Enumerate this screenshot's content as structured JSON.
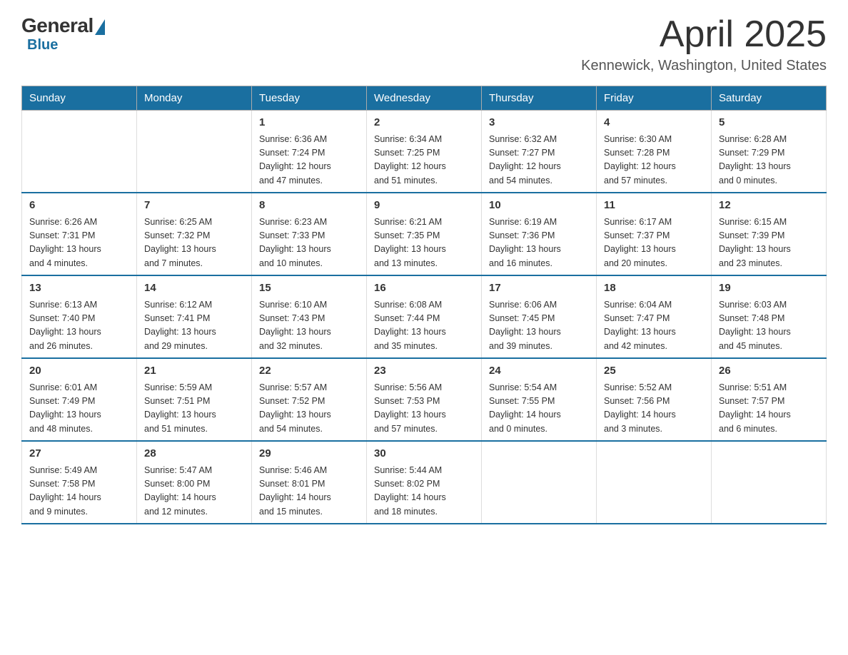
{
  "logo": {
    "general": "General",
    "blue": "Blue"
  },
  "header": {
    "month": "April 2025",
    "location": "Kennewick, Washington, United States"
  },
  "weekdays": [
    "Sunday",
    "Monday",
    "Tuesday",
    "Wednesday",
    "Thursday",
    "Friday",
    "Saturday"
  ],
  "weeks": [
    [
      {
        "day": "",
        "info": ""
      },
      {
        "day": "",
        "info": ""
      },
      {
        "day": "1",
        "info": "Sunrise: 6:36 AM\nSunset: 7:24 PM\nDaylight: 12 hours\nand 47 minutes."
      },
      {
        "day": "2",
        "info": "Sunrise: 6:34 AM\nSunset: 7:25 PM\nDaylight: 12 hours\nand 51 minutes."
      },
      {
        "day": "3",
        "info": "Sunrise: 6:32 AM\nSunset: 7:27 PM\nDaylight: 12 hours\nand 54 minutes."
      },
      {
        "day": "4",
        "info": "Sunrise: 6:30 AM\nSunset: 7:28 PM\nDaylight: 12 hours\nand 57 minutes."
      },
      {
        "day": "5",
        "info": "Sunrise: 6:28 AM\nSunset: 7:29 PM\nDaylight: 13 hours\nand 0 minutes."
      }
    ],
    [
      {
        "day": "6",
        "info": "Sunrise: 6:26 AM\nSunset: 7:31 PM\nDaylight: 13 hours\nand 4 minutes."
      },
      {
        "day": "7",
        "info": "Sunrise: 6:25 AM\nSunset: 7:32 PM\nDaylight: 13 hours\nand 7 minutes."
      },
      {
        "day": "8",
        "info": "Sunrise: 6:23 AM\nSunset: 7:33 PM\nDaylight: 13 hours\nand 10 minutes."
      },
      {
        "day": "9",
        "info": "Sunrise: 6:21 AM\nSunset: 7:35 PM\nDaylight: 13 hours\nand 13 minutes."
      },
      {
        "day": "10",
        "info": "Sunrise: 6:19 AM\nSunset: 7:36 PM\nDaylight: 13 hours\nand 16 minutes."
      },
      {
        "day": "11",
        "info": "Sunrise: 6:17 AM\nSunset: 7:37 PM\nDaylight: 13 hours\nand 20 minutes."
      },
      {
        "day": "12",
        "info": "Sunrise: 6:15 AM\nSunset: 7:39 PM\nDaylight: 13 hours\nand 23 minutes."
      }
    ],
    [
      {
        "day": "13",
        "info": "Sunrise: 6:13 AM\nSunset: 7:40 PM\nDaylight: 13 hours\nand 26 minutes."
      },
      {
        "day": "14",
        "info": "Sunrise: 6:12 AM\nSunset: 7:41 PM\nDaylight: 13 hours\nand 29 minutes."
      },
      {
        "day": "15",
        "info": "Sunrise: 6:10 AM\nSunset: 7:43 PM\nDaylight: 13 hours\nand 32 minutes."
      },
      {
        "day": "16",
        "info": "Sunrise: 6:08 AM\nSunset: 7:44 PM\nDaylight: 13 hours\nand 35 minutes."
      },
      {
        "day": "17",
        "info": "Sunrise: 6:06 AM\nSunset: 7:45 PM\nDaylight: 13 hours\nand 39 minutes."
      },
      {
        "day": "18",
        "info": "Sunrise: 6:04 AM\nSunset: 7:47 PM\nDaylight: 13 hours\nand 42 minutes."
      },
      {
        "day": "19",
        "info": "Sunrise: 6:03 AM\nSunset: 7:48 PM\nDaylight: 13 hours\nand 45 minutes."
      }
    ],
    [
      {
        "day": "20",
        "info": "Sunrise: 6:01 AM\nSunset: 7:49 PM\nDaylight: 13 hours\nand 48 minutes."
      },
      {
        "day": "21",
        "info": "Sunrise: 5:59 AM\nSunset: 7:51 PM\nDaylight: 13 hours\nand 51 minutes."
      },
      {
        "day": "22",
        "info": "Sunrise: 5:57 AM\nSunset: 7:52 PM\nDaylight: 13 hours\nand 54 minutes."
      },
      {
        "day": "23",
        "info": "Sunrise: 5:56 AM\nSunset: 7:53 PM\nDaylight: 13 hours\nand 57 minutes."
      },
      {
        "day": "24",
        "info": "Sunrise: 5:54 AM\nSunset: 7:55 PM\nDaylight: 14 hours\nand 0 minutes."
      },
      {
        "day": "25",
        "info": "Sunrise: 5:52 AM\nSunset: 7:56 PM\nDaylight: 14 hours\nand 3 minutes."
      },
      {
        "day": "26",
        "info": "Sunrise: 5:51 AM\nSunset: 7:57 PM\nDaylight: 14 hours\nand 6 minutes."
      }
    ],
    [
      {
        "day": "27",
        "info": "Sunrise: 5:49 AM\nSunset: 7:58 PM\nDaylight: 14 hours\nand 9 minutes."
      },
      {
        "day": "28",
        "info": "Sunrise: 5:47 AM\nSunset: 8:00 PM\nDaylight: 14 hours\nand 12 minutes."
      },
      {
        "day": "29",
        "info": "Sunrise: 5:46 AM\nSunset: 8:01 PM\nDaylight: 14 hours\nand 15 minutes."
      },
      {
        "day": "30",
        "info": "Sunrise: 5:44 AM\nSunset: 8:02 PM\nDaylight: 14 hours\nand 18 minutes."
      },
      {
        "day": "",
        "info": ""
      },
      {
        "day": "",
        "info": ""
      },
      {
        "day": "",
        "info": ""
      }
    ]
  ]
}
